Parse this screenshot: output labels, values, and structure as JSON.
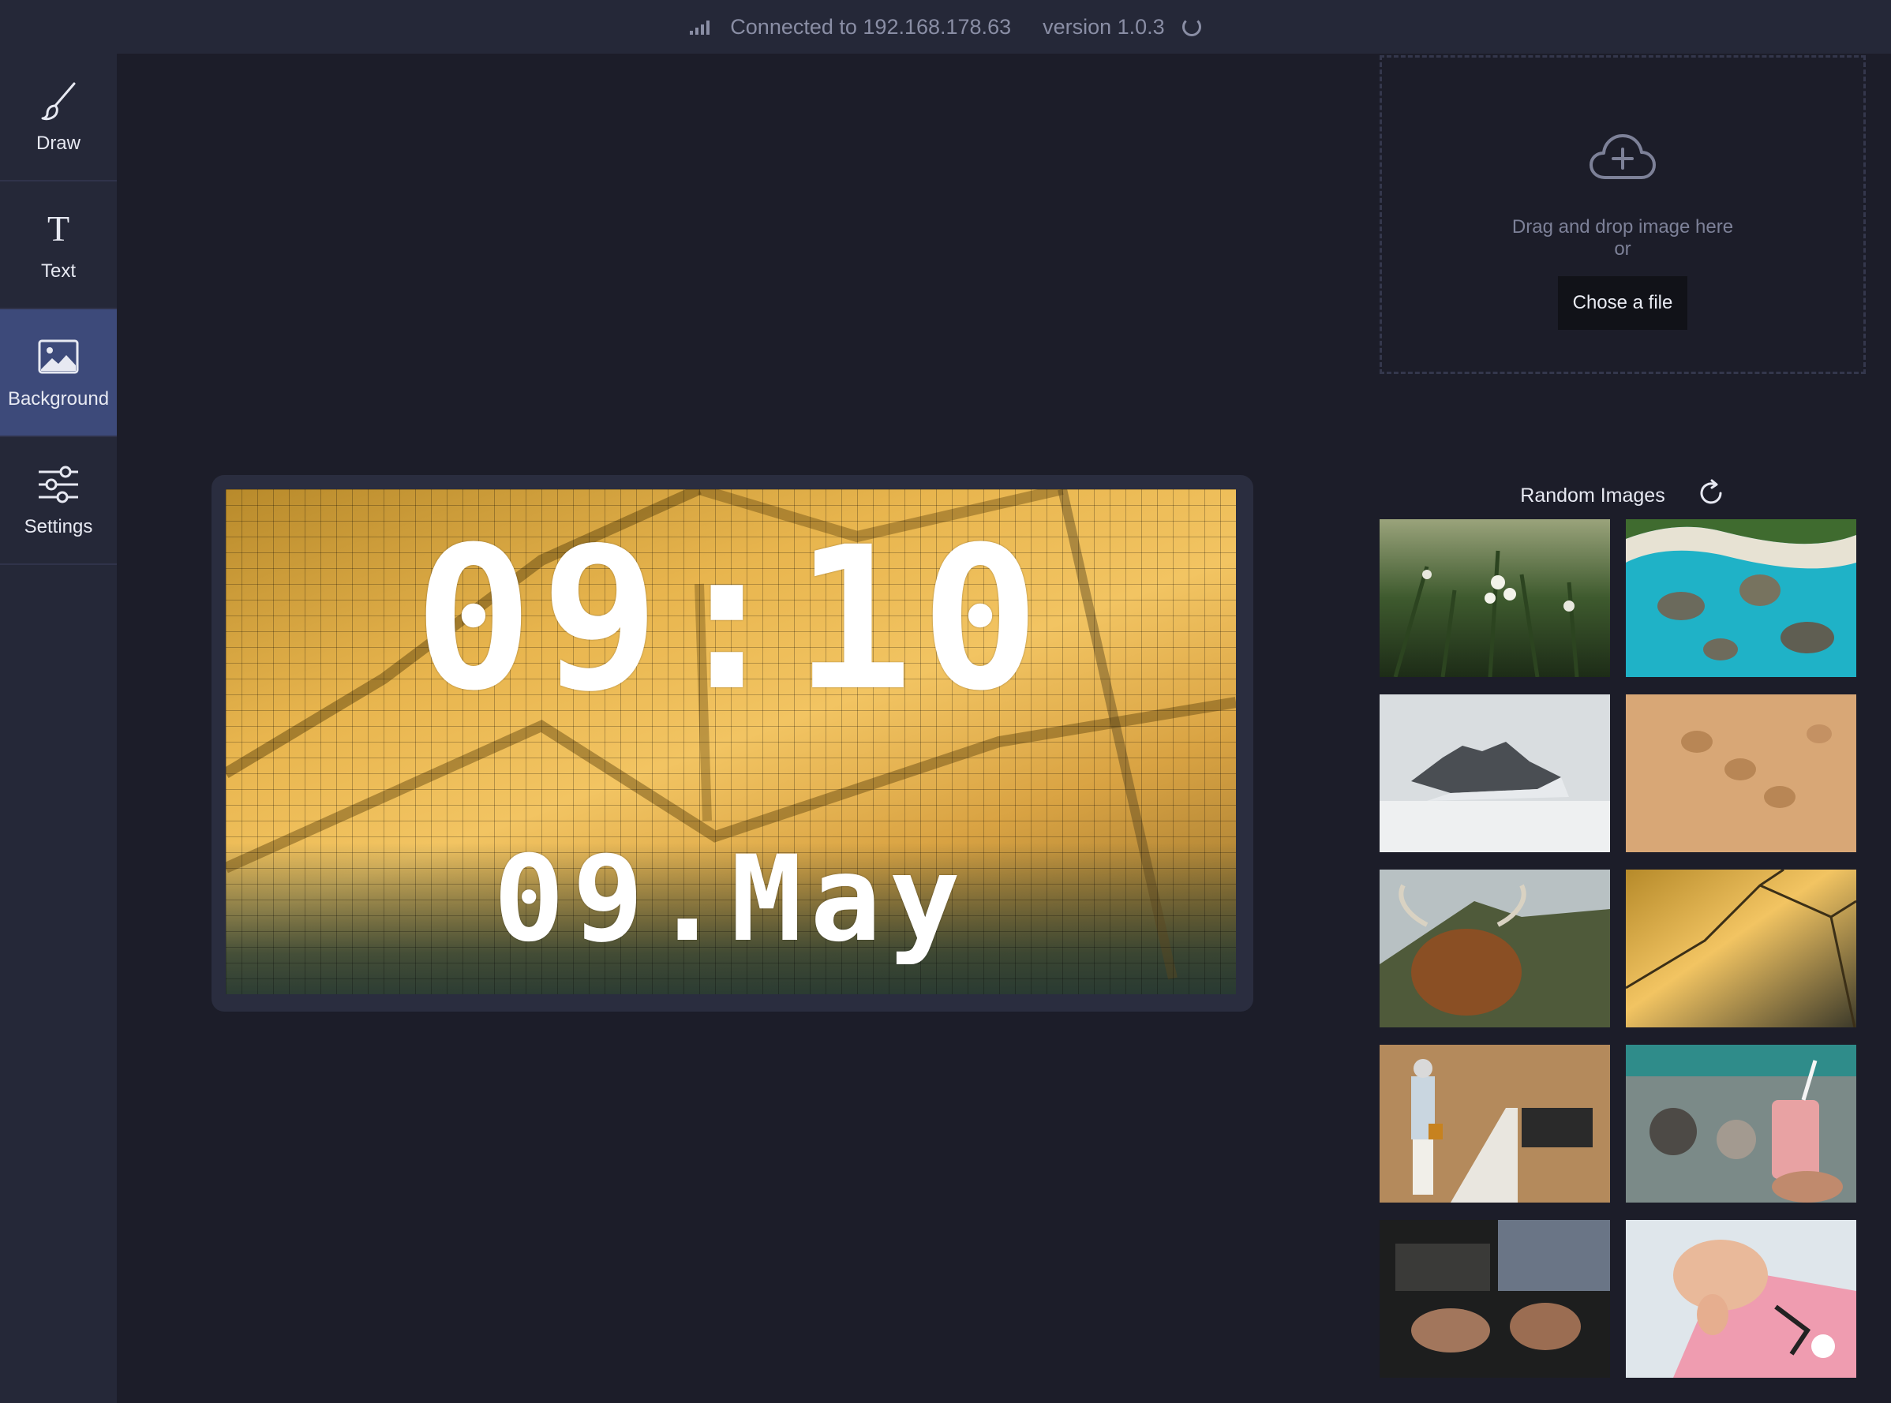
{
  "status": {
    "connection": "Connected to 192.168.178.63",
    "version": "version 1.0.3"
  },
  "sidebar": {
    "items": [
      {
        "label": "Draw",
        "icon": "brush-icon",
        "active": false
      },
      {
        "label": "Text",
        "icon": "text-icon",
        "active": false
      },
      {
        "label": "Background",
        "icon": "image-icon",
        "active": true
      },
      {
        "label": "Settings",
        "icon": "sliders-icon",
        "active": false
      }
    ]
  },
  "display": {
    "time": "09:10",
    "date": "09.May"
  },
  "upload": {
    "icon": "cloud-upload-icon",
    "drag_text": "Drag and drop image here",
    "or_text": "or",
    "choose_button": "Chose a file"
  },
  "random_images": {
    "title": "Random Images",
    "refresh_icon": "refresh-icon",
    "thumbnails": [
      {
        "name": "flowers-grass"
      },
      {
        "name": "turquoise-coast"
      },
      {
        "name": "misty-mountain"
      },
      {
        "name": "sand-footprints"
      },
      {
        "name": "highland-cow"
      },
      {
        "name": "golden-geometry"
      },
      {
        "name": "woman-brick-wall"
      },
      {
        "name": "drink-market"
      },
      {
        "name": "sewing-hands"
      },
      {
        "name": "baby-book"
      }
    ]
  },
  "colors": {
    "accent": "#3d4a7a",
    "background": "#1c1d29",
    "panel": "#252838"
  }
}
